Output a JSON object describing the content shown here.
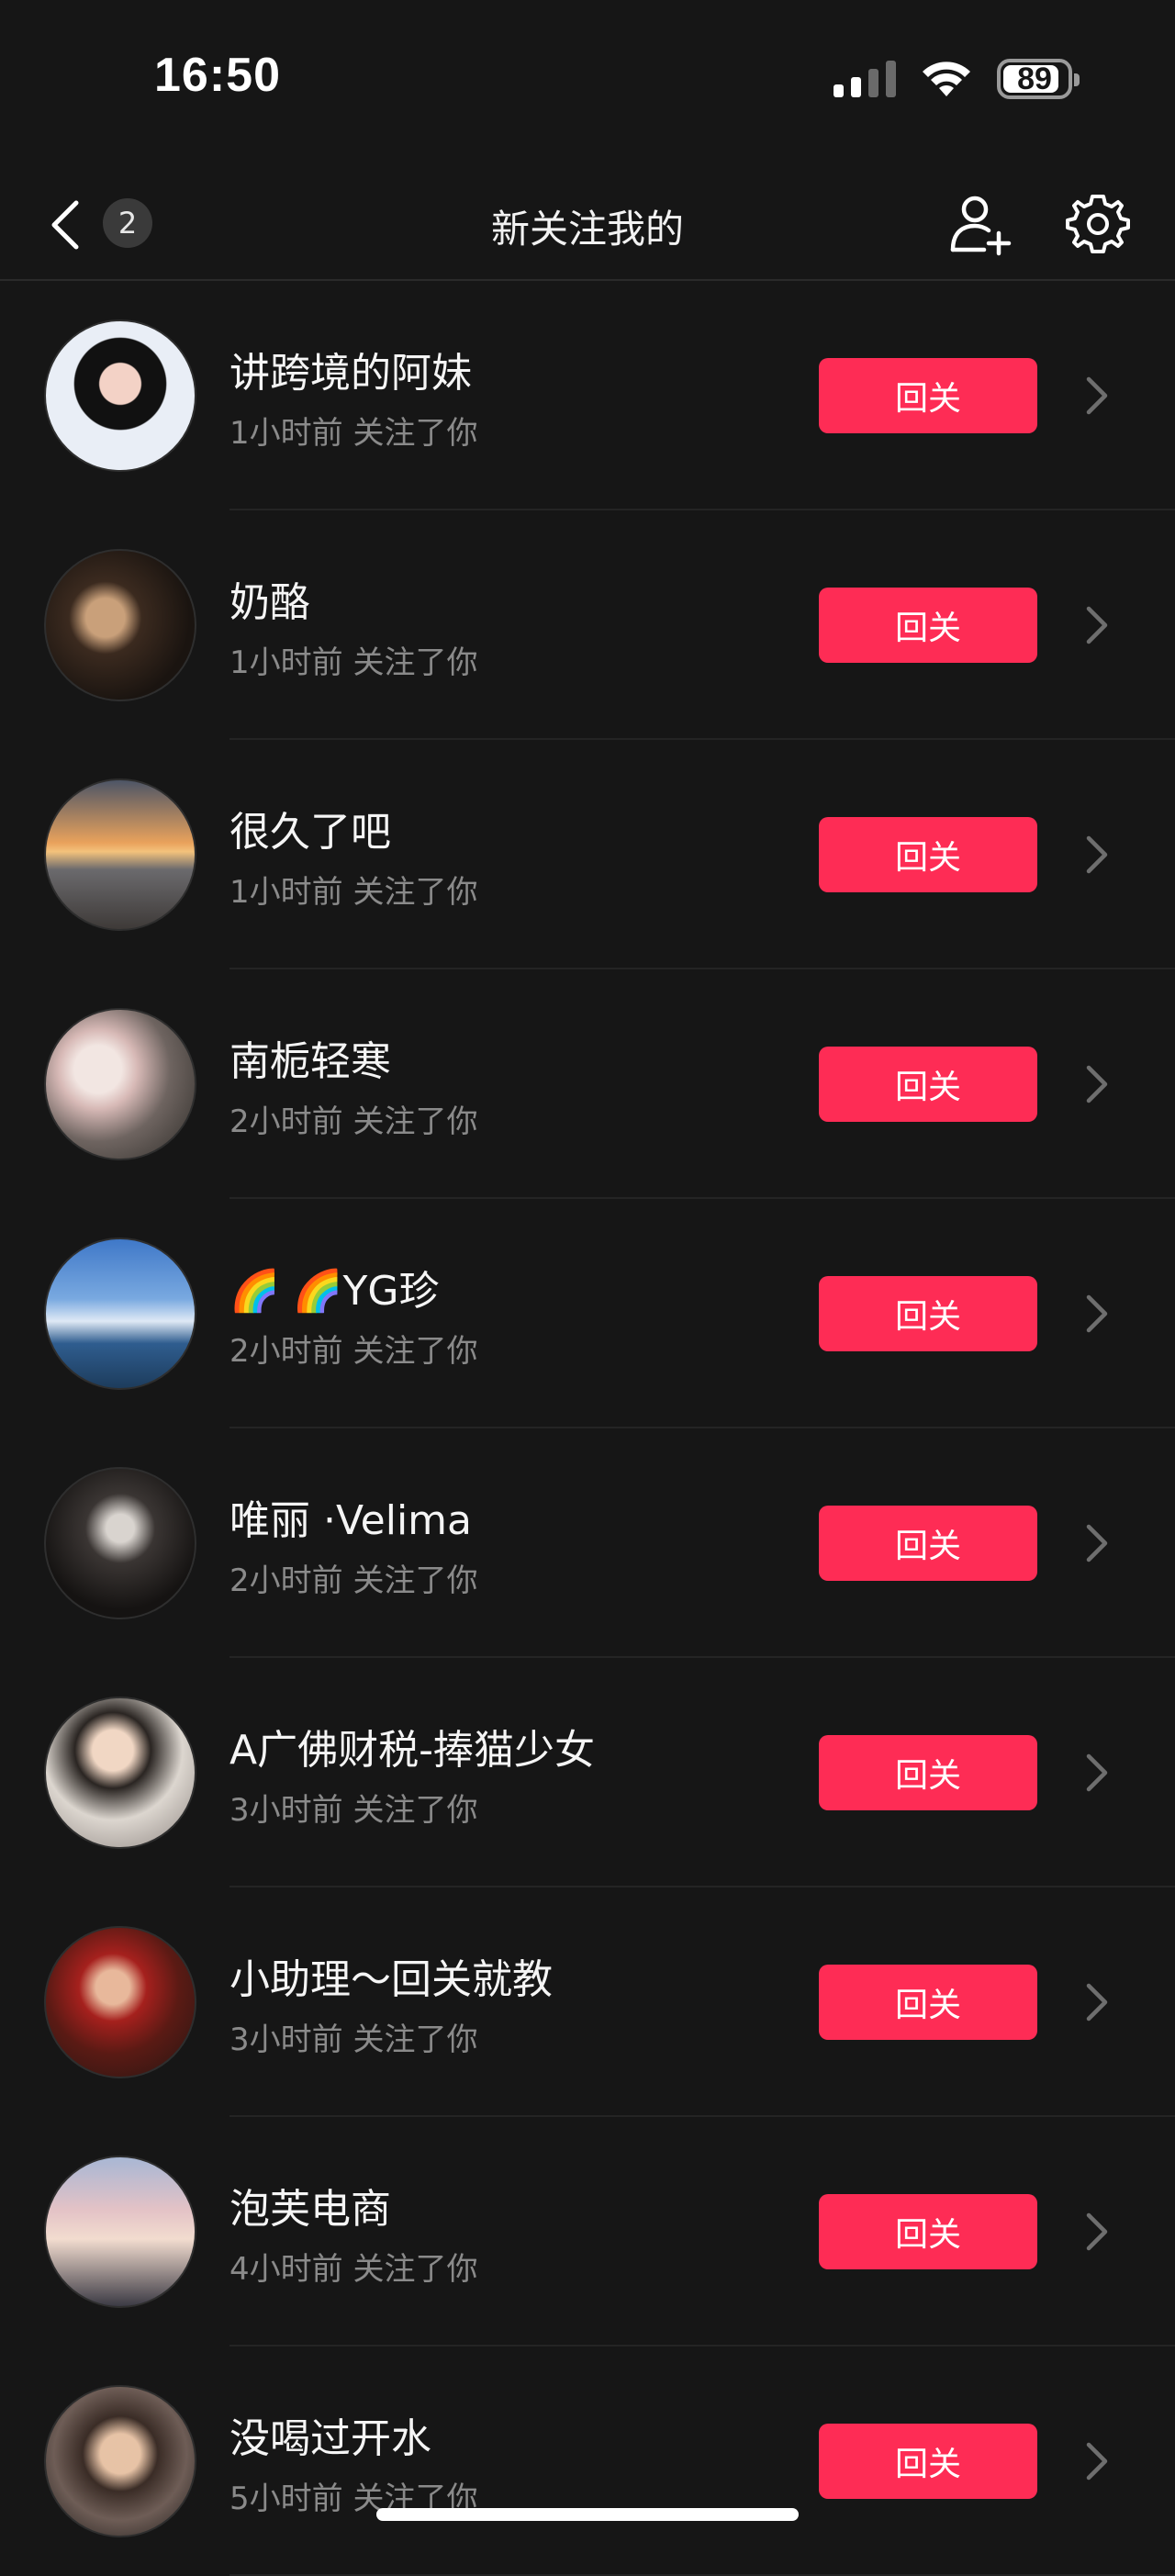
{
  "status_bar": {
    "time": "16:50",
    "battery_level": "89",
    "battery_fraction": 0.89
  },
  "nav": {
    "badge_count": "2",
    "title": "新关注我的"
  },
  "colors": {
    "background": "#161616",
    "follow_button": "#fe2c55",
    "secondary_text": "#8a8a8a"
  },
  "followers": [
    {
      "name": "讲跨境的阿妹",
      "subtitle": "1小时前 关注了你",
      "button": "回关",
      "avatar_icon": "cartoon-girl-avatar"
    },
    {
      "name": "奶酪",
      "subtitle": "1小时前 关注了你",
      "button": "回关",
      "avatar_icon": "photo-avatar"
    },
    {
      "name": "很久了吧",
      "subtitle": "1小时前 关注了你",
      "button": "回关",
      "avatar_icon": "sunset-avatar"
    },
    {
      "name": "南栀轻寒",
      "subtitle": "2小时前 关注了你",
      "button": "回关",
      "avatar_icon": "flowers-avatar"
    },
    {
      "name": "🌈 🌈YG珍",
      "subtitle": "2小时前 关注了你",
      "button": "回关",
      "avatar_icon": "sky-avatar"
    },
    {
      "name": "唯丽 ·Velima",
      "subtitle": "2小时前 关注了你",
      "button": "回关",
      "avatar_icon": "portrait-avatar"
    },
    {
      "name": "A广佛财税-捧猫少女",
      "subtitle": "3小时前 关注了你",
      "button": "回关",
      "avatar_icon": "girl-with-cat-avatar"
    },
    {
      "name": "小助理～回关就教",
      "subtitle": "3小时前 关注了你",
      "button": "回关",
      "avatar_icon": "girl-with-roses-avatar"
    },
    {
      "name": "泡芙电商",
      "subtitle": "4小时前 关注了你",
      "button": "回关",
      "avatar_icon": "girl-portrait-avatar"
    },
    {
      "name": "没喝过开水",
      "subtitle": "5小时前 关注了你",
      "button": "回关",
      "avatar_icon": "boy-portrait-avatar"
    }
  ]
}
